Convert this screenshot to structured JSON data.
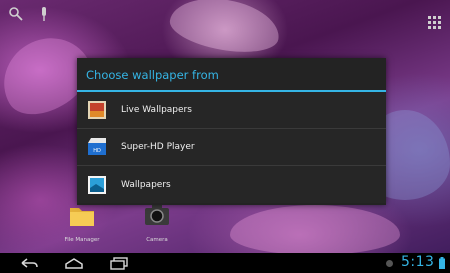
{
  "dialog": {
    "title": "Choose wallpaper from",
    "options": [
      {
        "label": "Live Wallpapers",
        "icon": "live-wallpaper-icon"
      },
      {
        "label": "Super-HD Player",
        "icon": "super-hd-player-icon"
      },
      {
        "label": "Wallpapers",
        "icon": "wallpapers-icon"
      }
    ]
  },
  "homescreen": {
    "shortcuts": [
      {
        "label": "File Manager",
        "icon": "folder-icon"
      },
      {
        "label": "Camera",
        "icon": "camera-icon"
      }
    ]
  },
  "status": {
    "time": "5:13"
  },
  "colors": {
    "accent": "#35b5e5",
    "dialog_bg": "#232323"
  }
}
